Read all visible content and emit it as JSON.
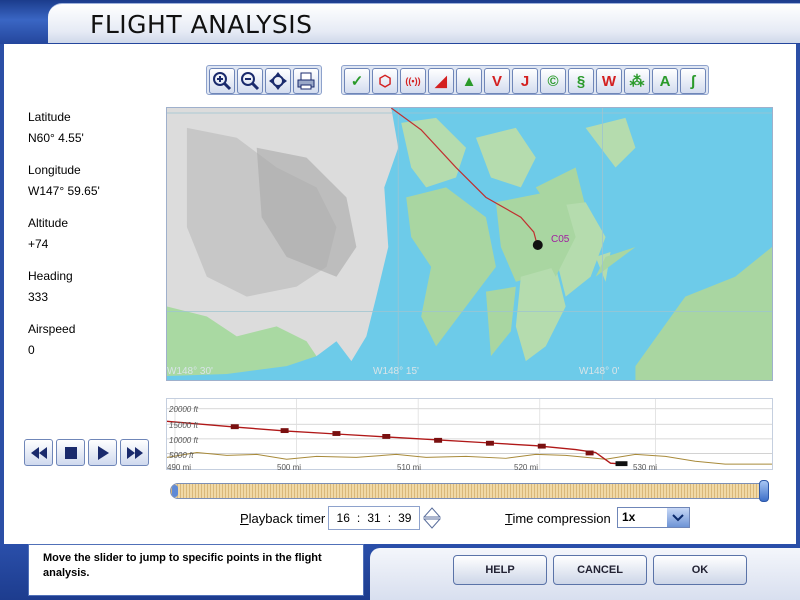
{
  "window": {
    "title": "FLIGHT ANALYSIS"
  },
  "toolbar": {
    "view_icons": [
      "zoom-in-icon",
      "zoom-out-icon",
      "center-icon",
      "print-icon"
    ],
    "map_icons": [
      {
        "name": "airport-icon",
        "glyph": "✓",
        "color": "#2a9a2a"
      },
      {
        "name": "vor-icon",
        "glyph": "⬡",
        "color": "#d42020"
      },
      {
        "name": "ndb-icon",
        "glyph": "((•))",
        "color": "#d42020"
      },
      {
        "name": "intersection-icon",
        "glyph": "◢",
        "color": "#d42020"
      },
      {
        "name": "triangle-icon",
        "glyph": "▲",
        "color": "#2a9a2a"
      },
      {
        "name": "victor-airways-icon",
        "glyph": "V",
        "color": "#d42020"
      },
      {
        "name": "jet-airways-icon",
        "glyph": "J",
        "color": "#d42020"
      },
      {
        "name": "atis-icon",
        "glyph": "©",
        "color": "#2a9a2a"
      },
      {
        "name": "route-icon",
        "glyph": "§",
        "color": "#2a9a2a"
      },
      {
        "name": "weather-icon",
        "glyph": "W",
        "color": "#d42020"
      },
      {
        "name": "terrain-icon",
        "glyph": "⁂",
        "color": "#2a9a2a"
      },
      {
        "name": "altitude-icon",
        "glyph": "A",
        "color": "#2a9a2a"
      },
      {
        "name": "wind-icon",
        "glyph": "ʃ",
        "color": "#2a9a2a"
      }
    ]
  },
  "info": {
    "latitude_label": "Latitude",
    "latitude_value": "N60° 4.55'",
    "longitude_label": "Longitude",
    "longitude_value": "W147° 59.65'",
    "altitude_label": "Altitude",
    "altitude_value": "+74",
    "heading_label": "Heading",
    "heading_value": "333",
    "airspeed_label": "Airspeed",
    "airspeed_value": "0"
  },
  "map": {
    "longitude_labels": [
      "W148° 30'",
      "W148° 15'",
      "W148° 0'"
    ],
    "airport_label": "C05"
  },
  "profile": {
    "altitude_labels": [
      "20000 ft",
      "15000 ft",
      "10000 ft",
      "5000 ft"
    ],
    "distance_labels": [
      "490 mi",
      "500 mi",
      "510 mi",
      "520 mi",
      "530 mi"
    ]
  },
  "slider": {
    "position": 1.0
  },
  "playback": {
    "buttons": [
      "rewind-icon",
      "stop-icon",
      "play-icon",
      "fast-forward-icon"
    ],
    "timer_label_prefix": "P",
    "timer_label_rest": "layback timer",
    "hours": "16",
    "minutes": "31",
    "seconds": "39",
    "time_compression_label_prefix": "T",
    "time_compression_label_rest": "ime compression",
    "time_compression_value": "1x"
  },
  "hint": "Move the slider to jump to specific points in the flight analysis.",
  "buttons": {
    "help": "HELP",
    "cancel": "CANCEL",
    "ok": "OK"
  }
}
